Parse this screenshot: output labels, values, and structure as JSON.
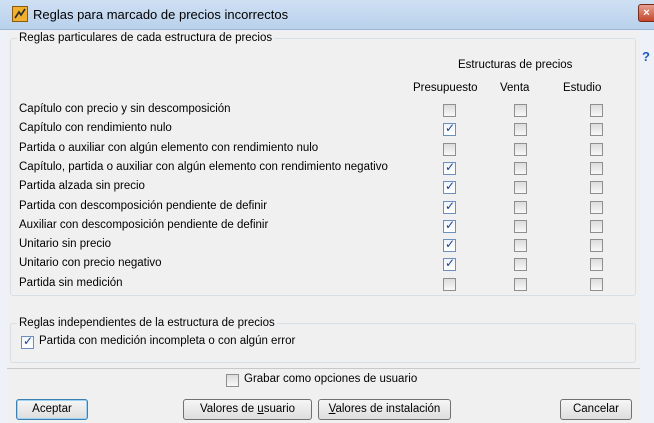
{
  "window": {
    "title": "Reglas para marcado de precios incorrectos",
    "close_glyph": "×",
    "help_glyph": "?",
    "icon_name": "app-icon",
    "close_icon_name": "close-icon",
    "help_icon_name": "help-icon"
  },
  "particular_group": {
    "legend": "Reglas particulares de cada estructura de precios",
    "header": "Estructuras de precios",
    "columns": [
      "Presupuesto",
      "Venta",
      "Estudio"
    ],
    "rows": [
      {
        "label": "Capítulo con precio y sin descomposición",
        "values": [
          false,
          false,
          false
        ]
      },
      {
        "label": "Capítulo con rendimiento nulo",
        "values": [
          true,
          false,
          false
        ]
      },
      {
        "label": "Partida o auxiliar con algún elemento con rendimiento nulo",
        "values": [
          false,
          false,
          false
        ]
      },
      {
        "label": "Capítulo, partida o auxiliar con algún elemento con rendimiento negativo",
        "values": [
          true,
          false,
          false
        ]
      },
      {
        "label": "Partida alzada sin precio",
        "values": [
          true,
          false,
          false
        ]
      },
      {
        "label": "Partida con descomposición pendiente de definir",
        "values": [
          true,
          false,
          false
        ]
      },
      {
        "label": "Auxiliar con descomposición pendiente de definir",
        "values": [
          true,
          false,
          false
        ]
      },
      {
        "label": "Unitario sin precio",
        "values": [
          true,
          false,
          false
        ]
      },
      {
        "label": "Unitario con precio negativo",
        "values": [
          true,
          false,
          false
        ]
      },
      {
        "label": "Partida sin medición",
        "values": [
          false,
          false,
          false
        ]
      }
    ]
  },
  "independent_group": {
    "legend": "Reglas independientes de la estructura de precios",
    "option_label": "Partida con medición incompleta o con algún error",
    "option_checked": true
  },
  "save_option": {
    "label": "Grabar como opciones de usuario",
    "checked": false
  },
  "buttons": {
    "accept": "Aceptar",
    "user_values_prefix": "Valores de ",
    "user_values_underlined": "u",
    "user_values_suffix": "suario",
    "install_values_underlined": "V",
    "install_values_suffix": "alores de instalación",
    "cancel": "Cancelar"
  }
}
